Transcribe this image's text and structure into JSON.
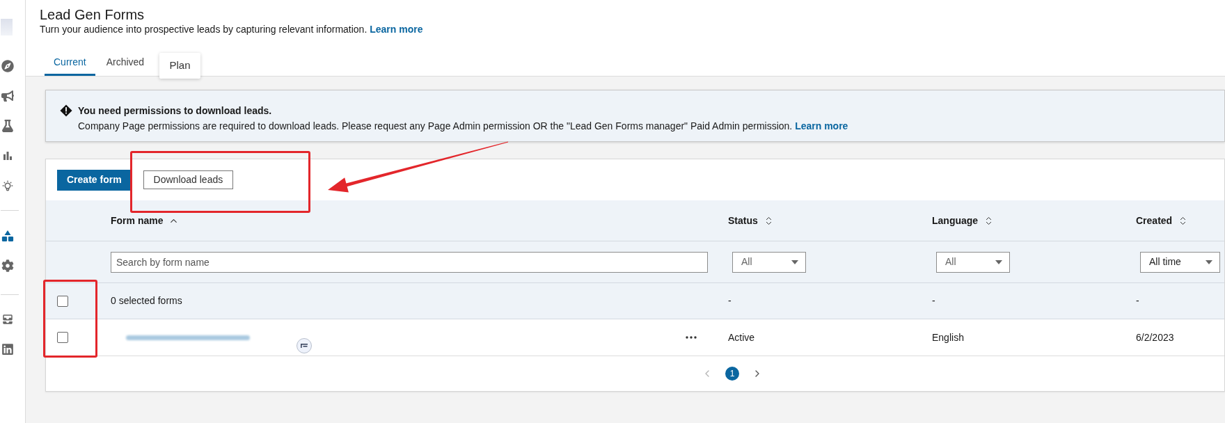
{
  "sidebar": {
    "groups": [
      {
        "items": [
          {
            "selected": false
          },
          {
            "selected": false
          },
          {
            "selected": false
          },
          {
            "selected": false
          },
          {
            "selected": false
          }
        ]
      },
      {
        "items": [
          {
            "selected": true
          },
          {
            "selected": false
          }
        ]
      },
      {
        "items": [
          {
            "selected": false
          },
          {
            "selected": false
          }
        ]
      }
    ]
  },
  "header": {
    "title": "Lead Gen Forms",
    "subtitle": "Turn your audience into prospective leads by capturing relevant information.",
    "link": "Learn more"
  },
  "tabs": [
    {
      "label": "Current",
      "selected": true
    },
    {
      "label": "Archived",
      "selected": false
    }
  ],
  "tooltip": {
    "text": "Plan"
  },
  "alert": {
    "title": "You need permissions to download leads.",
    "message": "Company Page permissions are required to download leads. Please request any Page Admin permission OR the \"Lead Gen Forms manager\" Paid Admin permission.",
    "link": "Learn more"
  },
  "toolbar": {
    "buttons": [
      {
        "label": "Create form",
        "kind": "primary"
      },
      {
        "label": "Download leads",
        "kind": "secondary"
      }
    ]
  },
  "table": {
    "columns": [
      {
        "label": "Form name",
        "sorted": true,
        "filter": {
          "kind": "search",
          "placeholder": "Search by form name"
        }
      },
      {
        "label": "Status",
        "sorted": false,
        "filter": {
          "kind": "select",
          "placeholder": "All"
        }
      },
      {
        "label": "Language",
        "sorted": false,
        "filter": {
          "kind": "select",
          "placeholder": "All"
        }
      },
      {
        "label": "Created",
        "sorted": false,
        "filter": {
          "kind": "select",
          "value": "All time"
        }
      }
    ],
    "summary_row": {
      "checked": false,
      "label": "0 selected forms",
      "status": "-",
      "language": "-",
      "created": "-"
    },
    "rows": [
      {
        "checked": false,
        "status": "Active",
        "language": "English",
        "created": "6/2/2023"
      }
    ]
  },
  "pagination": {
    "previous": {
      "disabled": true
    },
    "pages": [
      {
        "label": "1",
        "selected": true
      }
    ],
    "next": {
      "disabled": false
    }
  }
}
